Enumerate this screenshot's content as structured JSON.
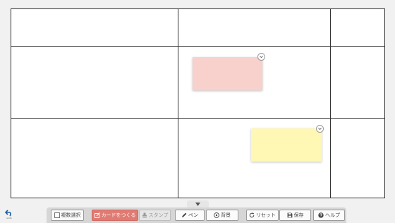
{
  "colors": {
    "board_bg": "#ffffff",
    "grid_line": "#333333",
    "card_pink": "#f8d0cc",
    "card_yellow": "#fef8b4",
    "primary_button": "#e07b73",
    "toolbar_bg": "#d6d6d6"
  },
  "board": {
    "cards": [
      {
        "name": "card-pink",
        "color": "pink",
        "text": ""
      },
      {
        "name": "card-yellow",
        "color": "yellow",
        "text": ""
      }
    ]
  },
  "toolbar": {
    "multi_select_label": "複数選択",
    "make_card_label": "カードをつくる",
    "stamp_label": "スタンプ",
    "pen_label": "ペン",
    "background_label": "背景",
    "reset_label": "リセット",
    "save_label": "保存",
    "help_label": "ヘルプ"
  },
  "undo": {
    "label": "undo",
    "icon": "undo-arrow-icon"
  }
}
